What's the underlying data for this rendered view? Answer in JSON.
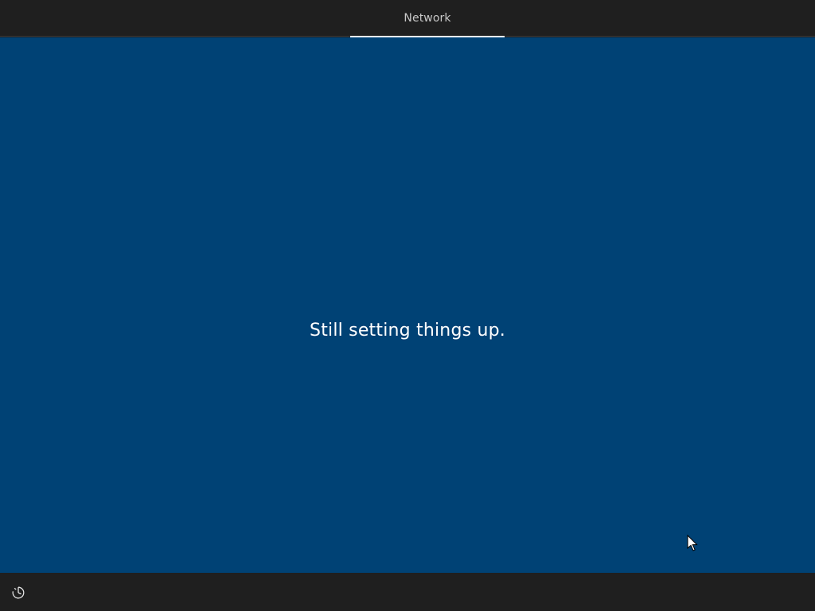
{
  "header": {
    "active_step": "Network"
  },
  "main": {
    "status_message": "Still setting things up."
  },
  "footer": {
    "accessibility_icon": "ease-of-access-icon"
  },
  "colors": {
    "panel_background": "#004275",
    "bar_background": "#1f1f1f",
    "text": "#ffffff"
  }
}
